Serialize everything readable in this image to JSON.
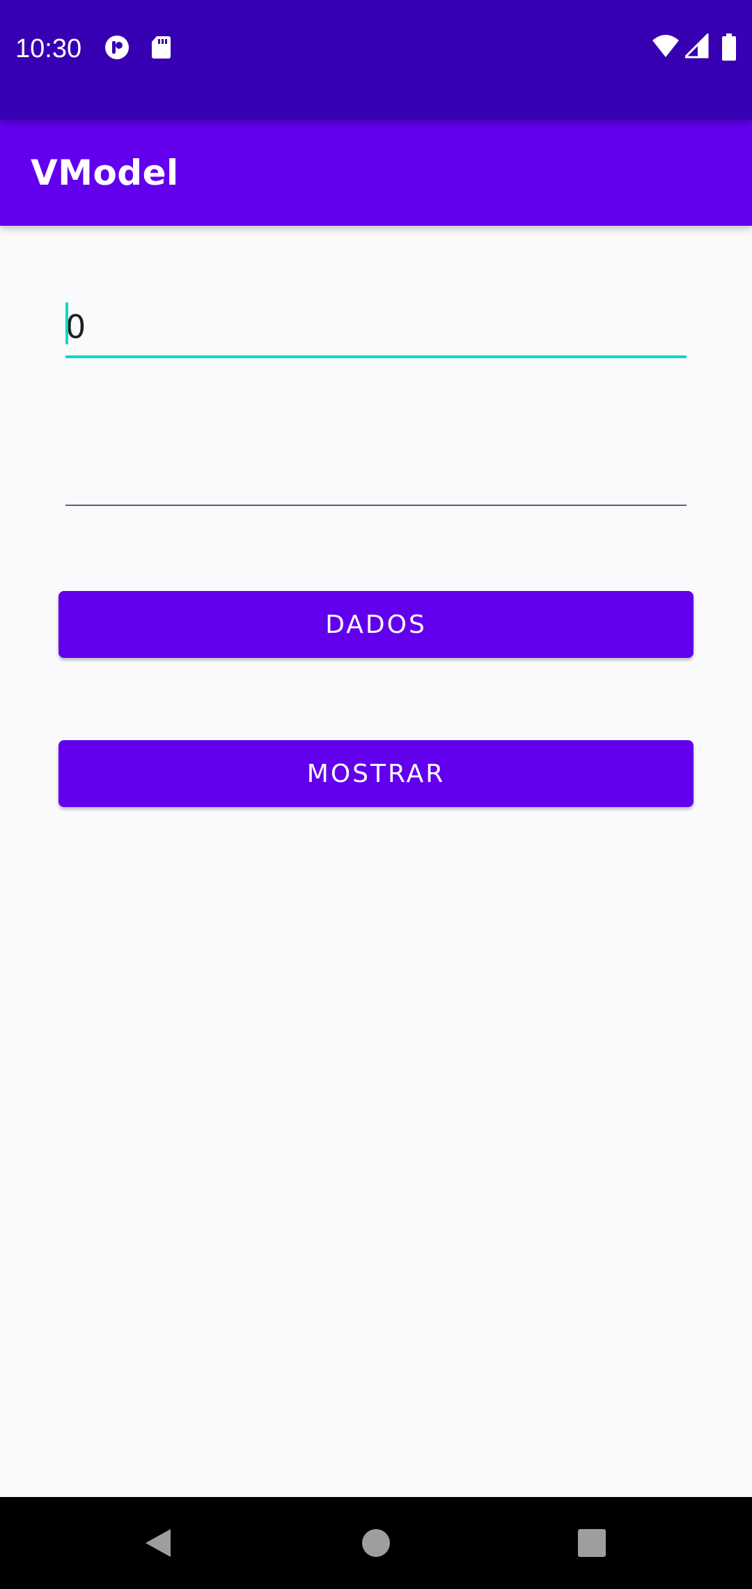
{
  "status_bar": {
    "time": "10:30",
    "left_icons": [
      "app-notification-icon",
      "sd-card-icon"
    ],
    "right_icons": [
      "wifi-icon",
      "cellular-signal-icon",
      "battery-icon"
    ],
    "background": "#3700B3"
  },
  "app_bar": {
    "title": "VModel",
    "background": "#6200EE"
  },
  "form": {
    "field1": {
      "value": "0",
      "placeholder": "",
      "focused": true,
      "accent": "#03DAC5"
    },
    "field2": {
      "value": "",
      "placeholder": ""
    }
  },
  "buttons": {
    "dados_label": "DADOS",
    "mostrar_label": "MOSTRAR",
    "color": "#6200EE"
  },
  "nav_bar": {
    "icons": [
      "back-icon",
      "home-icon",
      "recents-icon"
    ]
  }
}
